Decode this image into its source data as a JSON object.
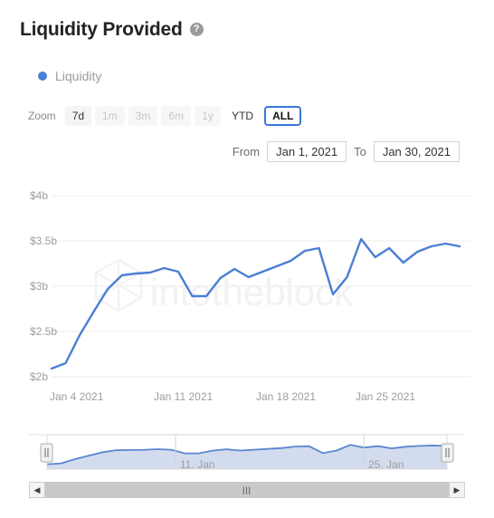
{
  "header": {
    "title": "Liquidity Provided",
    "help_icon": "question-mark-circle-icon"
  },
  "legend": {
    "items": [
      {
        "label": "Liquidity",
        "color": "#4a7fd4"
      }
    ]
  },
  "range_selector": {
    "label": "Zoom",
    "buttons": [
      {
        "label": "7d",
        "state": "enabled"
      },
      {
        "label": "1m",
        "state": "disabled"
      },
      {
        "label": "3m",
        "state": "disabled"
      },
      {
        "label": "6m",
        "state": "disabled"
      },
      {
        "label": "1y",
        "state": "disabled"
      },
      {
        "label": "YTD",
        "state": "enabled"
      },
      {
        "label": "ALL",
        "state": "active"
      }
    ]
  },
  "date_range": {
    "from_label": "From",
    "from_value": "Jan 1, 2021",
    "to_label": "To",
    "to_value": "Jan 30, 2021"
  },
  "watermark": {
    "text": "intotheblock"
  },
  "navigator": {
    "xticks": [
      "11. Jan",
      "25. Jan"
    ],
    "left_handle": "navigator-left-handle",
    "right_handle": "navigator-right-handle"
  },
  "scrollbar": {
    "left_arrow": "◀",
    "right_arrow": "▶",
    "grip": "|||"
  },
  "chart_data": {
    "type": "line",
    "title": "Liquidity Provided",
    "xlabel": "",
    "ylabel": "",
    "grid": true,
    "legend_position": "top-left",
    "ylim": [
      2.0,
      4.0
    ],
    "ytick_labels": [
      "$4b",
      "$3.5b",
      "$3b",
      "$2.5b",
      "$2b"
    ],
    "ytick_values": [
      4.0,
      3.5,
      3.0,
      2.5,
      2.0
    ],
    "xtick_labels": [
      "Jan 4 2021",
      "Jan 11 2021",
      "Jan 18 2021",
      "Jan 25 2021"
    ],
    "xtick_values": [
      "2021-01-04",
      "2021-01-11",
      "2021-01-18",
      "2021-01-25"
    ],
    "xlim": [
      "2021-01-01",
      "2021-01-30"
    ],
    "series": [
      {
        "name": "Liquidity",
        "color": "#4a7fd4",
        "unit": "USD billions",
        "x": [
          "2021-01-01",
          "2021-01-02",
          "2021-01-03",
          "2021-01-04",
          "2021-01-05",
          "2021-01-06",
          "2021-01-07",
          "2021-01-08",
          "2021-01-09",
          "2021-01-10",
          "2021-01-11",
          "2021-01-12",
          "2021-01-13",
          "2021-01-14",
          "2021-01-15",
          "2021-01-16",
          "2021-01-17",
          "2021-01-18",
          "2021-01-19",
          "2021-01-20",
          "2021-01-21",
          "2021-01-22",
          "2021-01-23",
          "2021-01-24",
          "2021-01-25",
          "2021-01-26",
          "2021-01-27",
          "2021-01-28",
          "2021-01-29",
          "2021-01-30"
        ],
        "values": [
          2.09,
          2.15,
          2.46,
          2.72,
          2.97,
          3.12,
          3.14,
          3.15,
          3.2,
          3.16,
          2.89,
          2.89,
          3.09,
          3.19,
          3.1,
          3.16,
          3.22,
          3.28,
          3.39,
          3.42,
          2.91,
          3.1,
          3.52,
          3.32,
          3.42,
          3.26,
          3.38,
          3.44,
          3.47,
          3.44
        ]
      }
    ],
    "navigator": {
      "visible_range": [
        "2021-01-01",
        "2021-01-30"
      ],
      "xtick_labels": [
        "11. Jan",
        "25. Jan"
      ]
    }
  }
}
